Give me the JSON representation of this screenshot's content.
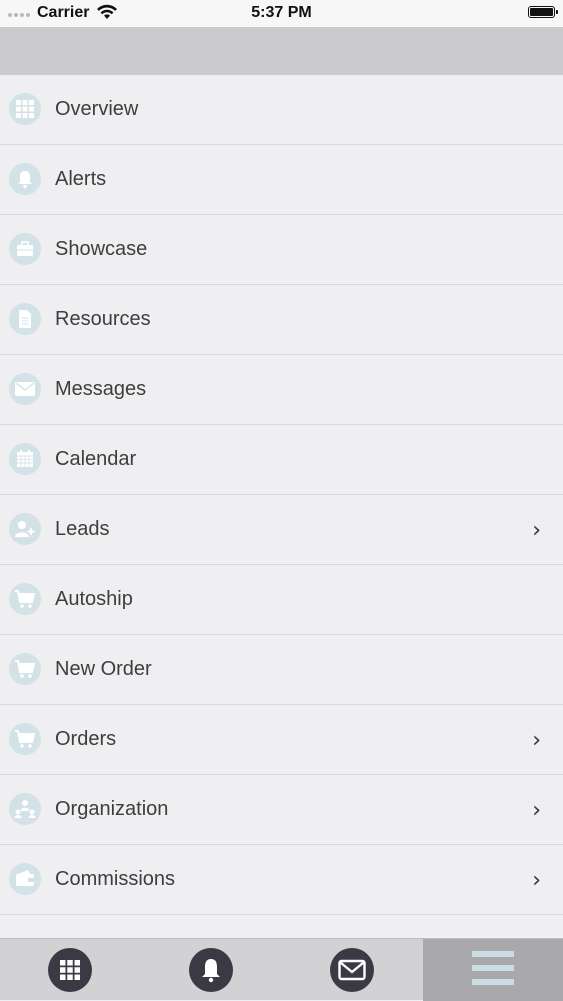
{
  "status_bar": {
    "carrier": "Carrier",
    "time": "5:37 PM"
  },
  "menu": {
    "items": [
      {
        "label": "Overview",
        "icon": "grid-icon",
        "chevron": false
      },
      {
        "label": "Alerts",
        "icon": "bell-icon",
        "chevron": false
      },
      {
        "label": "Showcase",
        "icon": "briefcase-icon",
        "chevron": false
      },
      {
        "label": "Resources",
        "icon": "document-icon",
        "chevron": false
      },
      {
        "label": "Messages",
        "icon": "envelope-icon",
        "chevron": false
      },
      {
        "label": "Calendar",
        "icon": "calendar-icon",
        "chevron": false
      },
      {
        "label": "Leads",
        "icon": "add-user-icon",
        "chevron": true
      },
      {
        "label": "Autoship",
        "icon": "cart-icon",
        "chevron": false
      },
      {
        "label": "New Order",
        "icon": "cart-add-icon",
        "chevron": false
      },
      {
        "label": "Orders",
        "icon": "cart-list-icon",
        "chevron": true
      },
      {
        "label": "Organization",
        "icon": "organization-icon",
        "chevron": true
      },
      {
        "label": "Commissions",
        "icon": "wallet-icon",
        "chevron": true
      }
    ]
  },
  "tab_bar": {
    "tabs": [
      {
        "icon": "grid-icon",
        "active": false
      },
      {
        "icon": "bell-icon",
        "active": false
      },
      {
        "icon": "envelope-icon",
        "active": false
      },
      {
        "icon": "hamburger-menu-icon",
        "active": true
      }
    ]
  },
  "colors": {
    "background": "#efeef1",
    "header": "#cacacd",
    "icon_circle": "#d3e2e6",
    "icon_glyph": "#ffffff",
    "tab_bar": "#d2d2d4",
    "tab_active": "#a9a9ac",
    "tab_icon_circle": "#3b3a44",
    "hamburger": "#c9dde3"
  }
}
